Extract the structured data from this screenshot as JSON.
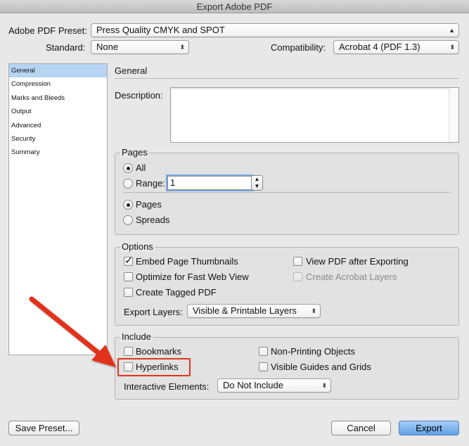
{
  "window": {
    "title": "Export Adobe PDF"
  },
  "preset": {
    "label": "Adobe PDF Preset:",
    "value": "Press Quality CMYK and SPOT"
  },
  "standard": {
    "label": "Standard:",
    "value": "None"
  },
  "compatibility": {
    "label": "Compatibility:",
    "value": "Acrobat 4 (PDF 1.3)"
  },
  "sidebar": {
    "items": [
      {
        "label": "General"
      },
      {
        "label": "Compression"
      },
      {
        "label": "Marks and Bleeds"
      },
      {
        "label": "Output"
      },
      {
        "label": "Advanced"
      },
      {
        "label": "Security"
      },
      {
        "label": "Summary"
      }
    ],
    "selected": "General"
  },
  "general": {
    "title": "General",
    "description_label": "Description:",
    "description_value": ""
  },
  "pages": {
    "title": "Pages",
    "all_label": "All",
    "range_label": "Range:",
    "range_value": "1",
    "pages_label": "Pages",
    "spreads_label": "Spreads"
  },
  "options": {
    "title": "Options",
    "embed_thumbnails": "Embed Page Thumbnails",
    "optimize_web": "Optimize for Fast Web View",
    "tagged_pdf": "Create Tagged PDF",
    "view_after": "View PDF after Exporting",
    "acrobat_layers": "Create Acrobat Layers",
    "export_layers_label": "Export Layers:",
    "export_layers_value": "Visible & Printable Layers"
  },
  "include": {
    "title": "Include",
    "bookmarks": "Bookmarks",
    "hyperlinks": "Hyperlinks",
    "non_printing": "Non-Printing Objects",
    "visible_guides": "Visible Guides and Grids",
    "interactive_label": "Interactive Elements:",
    "interactive_value": "Do Not Include"
  },
  "footer": {
    "save_preset": "Save Preset...",
    "cancel": "Cancel",
    "export": "Export"
  },
  "colors": {
    "annotation": "#e1331c",
    "selection": "#b6d4f2",
    "primary_button": "#5ea0e6"
  }
}
